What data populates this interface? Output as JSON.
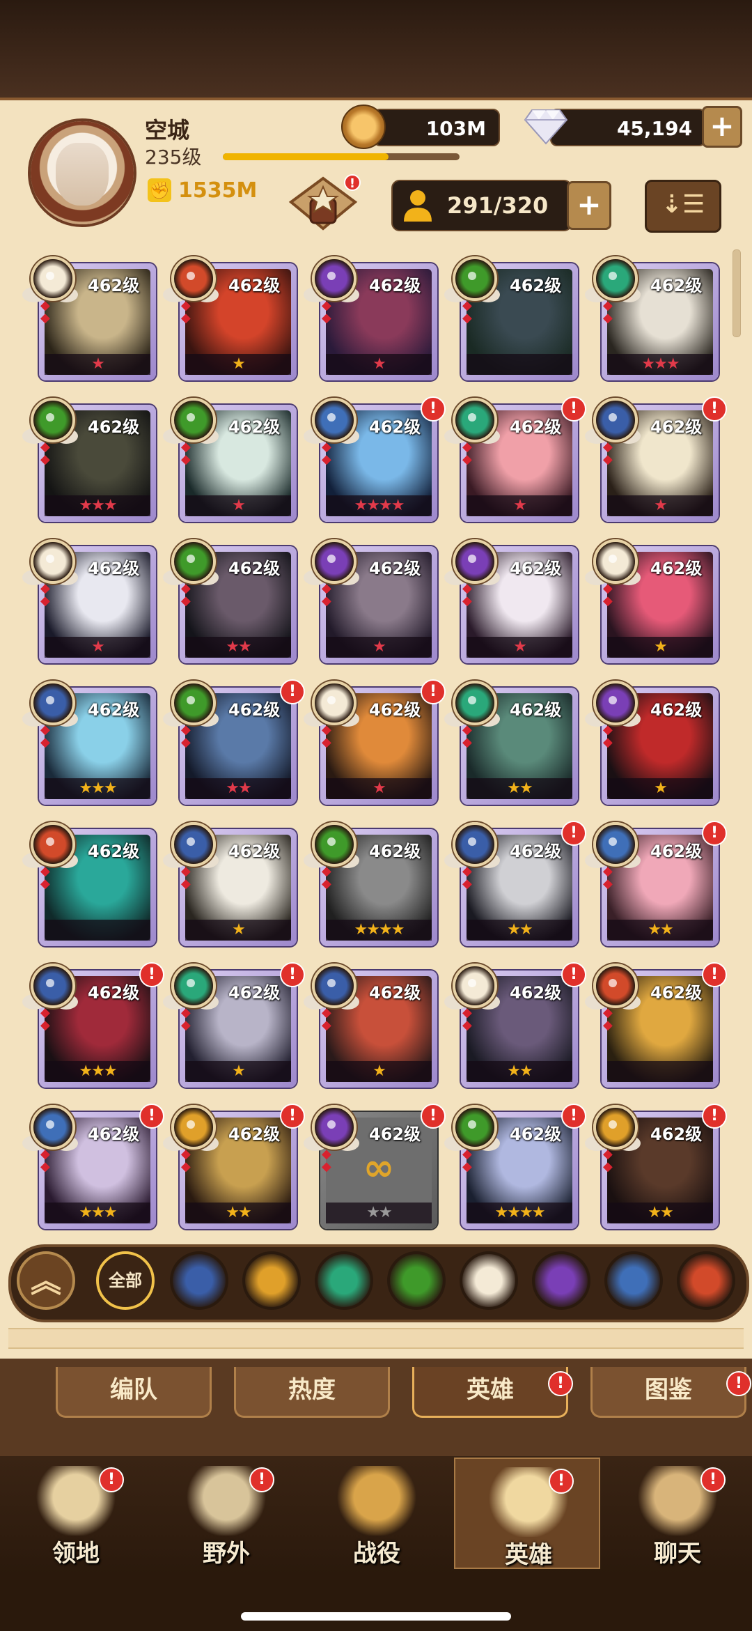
{
  "player": {
    "name": "空城",
    "level": "235级",
    "power": "1535M",
    "xp_fraction": 0.7
  },
  "currency": {
    "gold": "103M",
    "diamonds": "45,194",
    "plus": "+"
  },
  "hero_count": "291/320",
  "sort_label": "⇣☰",
  "heroes": [
    {
      "level": "462级",
      "stars": "★",
      "star_color": "#e23a4a",
      "faction": "holy",
      "alert": false,
      "locked": false
    },
    {
      "level": "462级",
      "stars": "★",
      "star_color": "#f2b21a",
      "faction": "inferno",
      "alert": false,
      "locked": false
    },
    {
      "level": "462级",
      "stars": "★",
      "star_color": "#e23a4a",
      "faction": "void",
      "alert": false,
      "locked": false
    },
    {
      "level": "462级",
      "stars": "",
      "star_color": "#e23a4a",
      "faction": "eye",
      "alert": false,
      "locked": false
    },
    {
      "level": "462级",
      "stars": "★★★",
      "star_color": "#e23a4a",
      "faction": "wild",
      "alert": false,
      "locked": false
    },
    {
      "level": "462级",
      "stars": "★★★",
      "star_color": "#e23a4a",
      "faction": "eye",
      "alert": false,
      "locked": false
    },
    {
      "level": "462级",
      "stars": "★",
      "star_color": "#e23a4a",
      "faction": "eye",
      "alert": false,
      "locked": false
    },
    {
      "level": "462级",
      "stars": "★★★★",
      "star_color": "#e23a4a",
      "faction": "dimension",
      "alert": true,
      "locked": false
    },
    {
      "level": "462级",
      "stars": "★",
      "star_color": "#e23a4a",
      "faction": "wild",
      "alert": true,
      "locked": false
    },
    {
      "level": "462级",
      "stars": "★",
      "star_color": "#e23a4a",
      "faction": "star",
      "alert": true,
      "locked": false
    },
    {
      "level": "462级",
      "stars": "★",
      "star_color": "#e23a4a",
      "faction": "holy",
      "alert": false,
      "locked": false
    },
    {
      "level": "462级",
      "stars": "★★",
      "star_color": "#e23a4a",
      "faction": "eye",
      "alert": false,
      "locked": false
    },
    {
      "level": "462级",
      "stars": "★",
      "star_color": "#e23a4a",
      "faction": "void",
      "alert": false,
      "locked": false
    },
    {
      "level": "462级",
      "stars": "★",
      "star_color": "#e23a4a",
      "faction": "void",
      "alert": false,
      "locked": false
    },
    {
      "level": "462级",
      "stars": "★",
      "star_color": "#f2b21a",
      "faction": "holy",
      "alert": false,
      "locked": false
    },
    {
      "level": "462级",
      "stars": "★★★",
      "star_color": "#f2b21a",
      "faction": "star",
      "alert": false,
      "locked": false
    },
    {
      "level": "462级",
      "stars": "★★",
      "star_color": "#e23a4a",
      "faction": "eye",
      "alert": true,
      "locked": false
    },
    {
      "level": "462级",
      "stars": "★",
      "star_color": "#e23a4a",
      "faction": "holy",
      "alert": true,
      "locked": false
    },
    {
      "level": "462级",
      "stars": "★★",
      "star_color": "#f2b21a",
      "faction": "wild",
      "alert": false,
      "locked": false
    },
    {
      "level": "462级",
      "stars": "★",
      "star_color": "#f2b21a",
      "faction": "void",
      "alert": false,
      "locked": false
    },
    {
      "level": "462级",
      "stars": "",
      "star_color": "#f2b21a",
      "faction": "inferno",
      "alert": false,
      "locked": false
    },
    {
      "level": "462级",
      "stars": "★",
      "star_color": "#f2b21a",
      "faction": "star",
      "alert": false,
      "locked": false
    },
    {
      "level": "462级",
      "stars": "★★★★",
      "star_color": "#f2b21a",
      "faction": "eye",
      "alert": false,
      "locked": false
    },
    {
      "level": "462级",
      "stars": "★★",
      "star_color": "#f2b21a",
      "faction": "star",
      "alert": true,
      "locked": false
    },
    {
      "level": "462级",
      "stars": "★★",
      "star_color": "#f2b21a",
      "faction": "dimension",
      "alert": true,
      "locked": false
    },
    {
      "level": "462级",
      "stars": "★★★",
      "star_color": "#f2b21a",
      "faction": "star",
      "alert": true,
      "locked": false
    },
    {
      "level": "462级",
      "stars": "★",
      "star_color": "#f2b21a",
      "faction": "wild",
      "alert": true,
      "locked": false
    },
    {
      "level": "462级",
      "stars": "★",
      "star_color": "#f2b21a",
      "faction": "star",
      "alert": false,
      "locked": false
    },
    {
      "level": "462级",
      "stars": "★★",
      "star_color": "#f2b21a",
      "faction": "holy",
      "alert": true,
      "locked": false
    },
    {
      "level": "462级",
      "stars": "",
      "star_color": "#f2b21a",
      "faction": "inferno",
      "alert": true,
      "locked": false
    },
    {
      "level": "462级",
      "stars": "★★★",
      "star_color": "#f2b21a",
      "faction": "dimension",
      "alert": true,
      "locked": false
    },
    {
      "level": "462级",
      "stars": "★★",
      "star_color": "#f2b21a",
      "faction": "celestial",
      "alert": true,
      "locked": false
    },
    {
      "level": "462级",
      "stars": "★★",
      "star_color": "#9a9a9a",
      "faction": "void",
      "alert": true,
      "locked": true
    },
    {
      "level": "462级",
      "stars": "★★★★",
      "star_color": "#f2b21a",
      "faction": "eye",
      "alert": true,
      "locked": false
    },
    {
      "level": "462级",
      "stars": "★★",
      "star_color": "#f2b21a",
      "faction": "celestial",
      "alert": true,
      "locked": false
    }
  ],
  "factions": {
    "holy": "#f4ead6",
    "inferno": "#d24a2a",
    "void": "#7a3fb6",
    "eye": "#3f9a2a",
    "wild": "#2aa87a",
    "dimension": "#3f6fb8",
    "star": "#3a5ea8",
    "celestial": "#e0a02a"
  },
  "filters": {
    "all_label": "全部",
    "up_label": "︽",
    "items": [
      {
        "icon": "star-faction-icon",
        "color": "#3a5ea8"
      },
      {
        "icon": "celestial-faction-icon",
        "color": "#e0a02a"
      },
      {
        "icon": "wild-faction-icon",
        "color": "#2aa87a"
      },
      {
        "icon": "eye-faction-icon",
        "color": "#3f9a2a"
      },
      {
        "icon": "holy-faction-icon",
        "color": "#f4ead6"
      },
      {
        "icon": "void-faction-icon",
        "color": "#7a3fb6"
      },
      {
        "icon": "dimension-faction-icon",
        "color": "#3f6fb8"
      },
      {
        "icon": "inferno-faction-icon",
        "color": "#d24a2a"
      }
    ]
  },
  "subtabs": [
    {
      "label": "编队",
      "alert": false
    },
    {
      "label": "热度",
      "alert": false
    },
    {
      "label": "英雄",
      "alert": true
    },
    {
      "label": "图鉴",
      "alert": true
    }
  ],
  "nav": [
    {
      "label": "领地",
      "alert": true,
      "active": false
    },
    {
      "label": "野外",
      "alert": true,
      "active": false
    },
    {
      "label": "战役",
      "alert": false,
      "active": false
    },
    {
      "label": "英雄",
      "alert": true,
      "active": true
    },
    {
      "label": "聊天",
      "alert": true,
      "active": false
    }
  ],
  "alert_mark": "!"
}
